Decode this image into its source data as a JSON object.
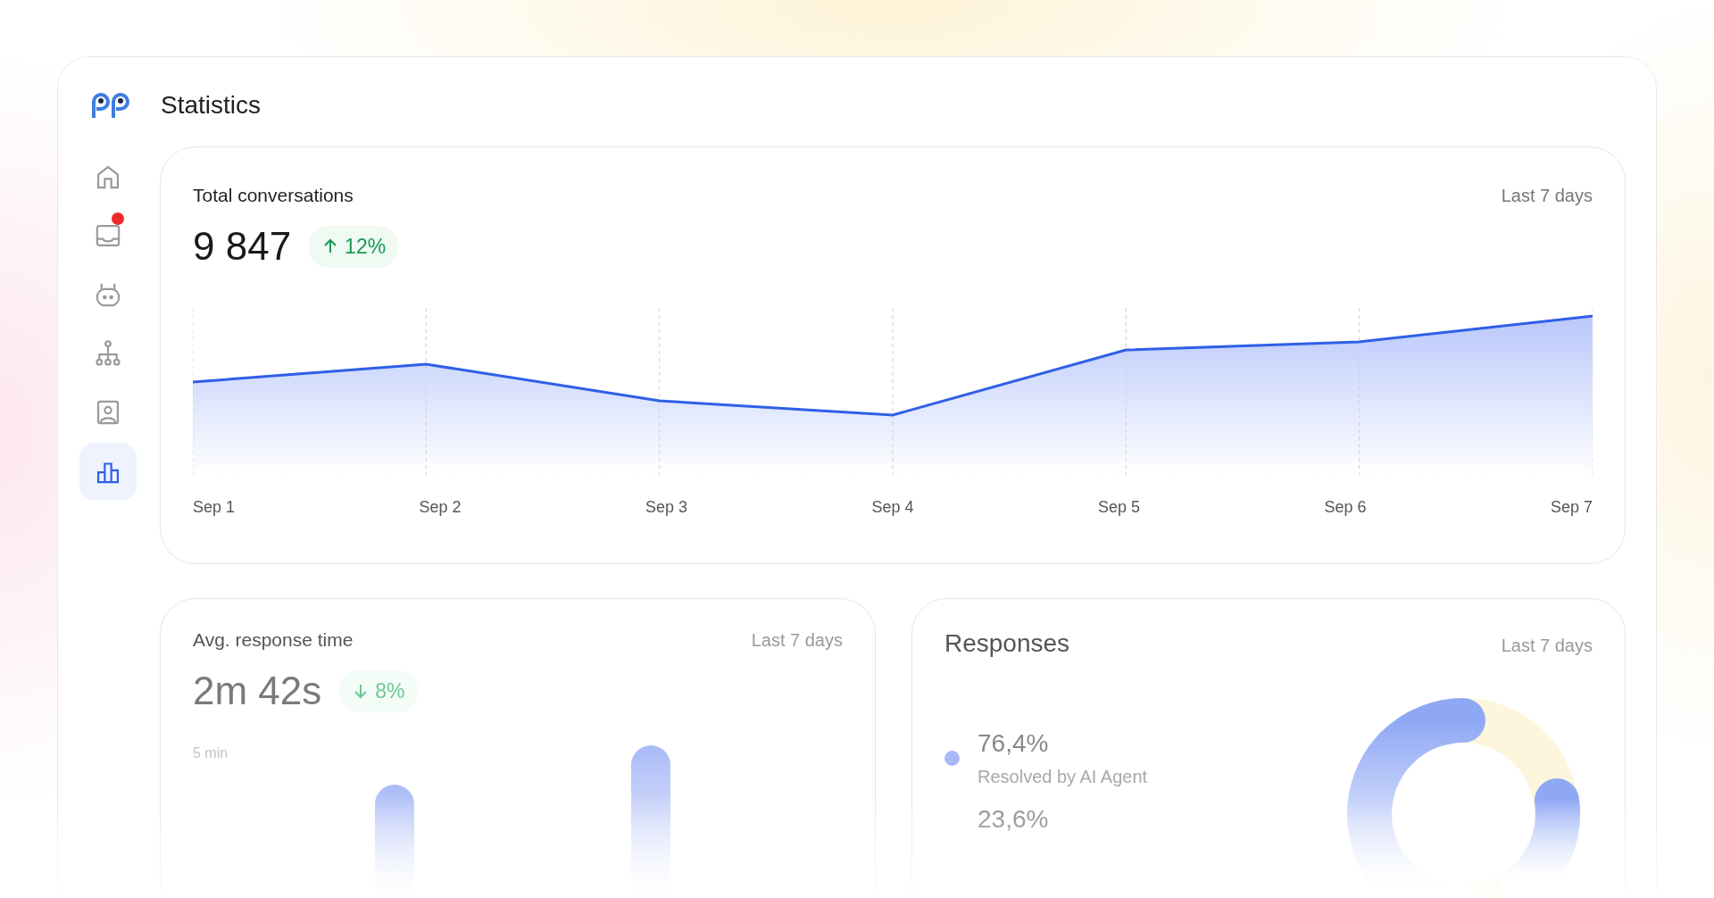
{
  "header": {
    "title": "Statistics"
  },
  "sidebar": {
    "items": [
      {
        "kind": "home",
        "selected": false,
        "notification": false
      },
      {
        "kind": "inbox",
        "selected": false,
        "notification": true
      },
      {
        "kind": "bot",
        "selected": false,
        "notification": false
      },
      {
        "kind": "hierarchy",
        "selected": false,
        "notification": false
      },
      {
        "kind": "contact",
        "selected": false,
        "notification": false
      },
      {
        "kind": "chart",
        "selected": true,
        "notification": false
      }
    ]
  },
  "total_conversations": {
    "title": "Total conversations",
    "period": "Last 7 days",
    "value": "9 847",
    "trend": {
      "kind": "up",
      "change": "12%"
    },
    "x_labels": [
      "Sep 1",
      "Sep 2",
      "Sep 3",
      "Sep 4",
      "Sep 5",
      "Sep 6",
      "Sep 7"
    ]
  },
  "avg_response_time": {
    "title": "Avg. response time",
    "period": "Last 7 days",
    "value": "2m 42s",
    "trend": {
      "kind": "down",
      "change": "8%"
    },
    "axis_label": "5 min"
  },
  "responses": {
    "title": "Responses",
    "period": "Last 7 days",
    "legend": [
      {
        "value": "76,4%",
        "label": "Resolved by AI Agent",
        "color": "#aab8f6"
      },
      {
        "value": "23,6%"
      }
    ]
  }
}
